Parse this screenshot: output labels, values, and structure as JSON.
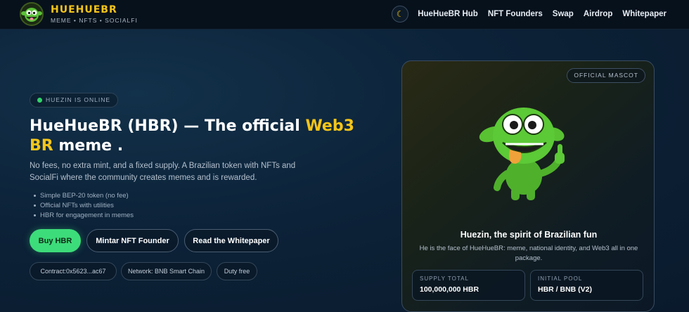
{
  "brand": {
    "title": "HUEHUEBR",
    "subtitle": "MEME • NFTS • SOCIALFI",
    "logo_icon": "goblin-mascot-icon"
  },
  "nav": {
    "theme_icon": "moon-icon",
    "theme_glyph": "☾",
    "links": [
      "HueHueBR Hub",
      "NFT Founders",
      "Swap",
      "Airdrop",
      "Whitepaper"
    ]
  },
  "hero": {
    "status": "HUEZIN IS ONLINE",
    "title_part1": "HueHueBR (HBR) — The official ",
    "title_highlight": "Web3 BR",
    "title_part2": " meme .",
    "description": "No fees, no extra mint, and a fixed supply. A Brazilian token with NFTs and SocialFi where the community creates memes and is rewarded.",
    "bullets": [
      "Simple BEP-20 token (no fee)",
      "Official NFTs with utilities",
      "HBR for engagement in memes"
    ],
    "buttons": {
      "buy": "Buy HBR",
      "mint": "Mintar NFT Founder",
      "whitepaper": "Read the Whitepaper"
    },
    "chips": {
      "contract": "Contract:0x5623...ac67",
      "network": "Network: BNB Smart Chain",
      "duty": "Duty free"
    }
  },
  "mascot": {
    "badge": "OFFICIAL MASCOT",
    "icon": "goblin-mascot-illustration",
    "name": "Huezin, the spirit of Brazilian fun",
    "description": "He is the face of HueHueBR: meme, national identity, and Web3 all in one package.",
    "stats": [
      {
        "label": "SUPPLY TOTAL",
        "value": "100,000,000 HBR"
      },
      {
        "label": "INITIAL POOL",
        "value": "HBR / BNB (V2)"
      }
    ]
  },
  "colors": {
    "accent_yellow": "#f5c518",
    "accent_green": "#3ddc7a",
    "background": "#0c2238",
    "nav_background": "#07111c"
  }
}
